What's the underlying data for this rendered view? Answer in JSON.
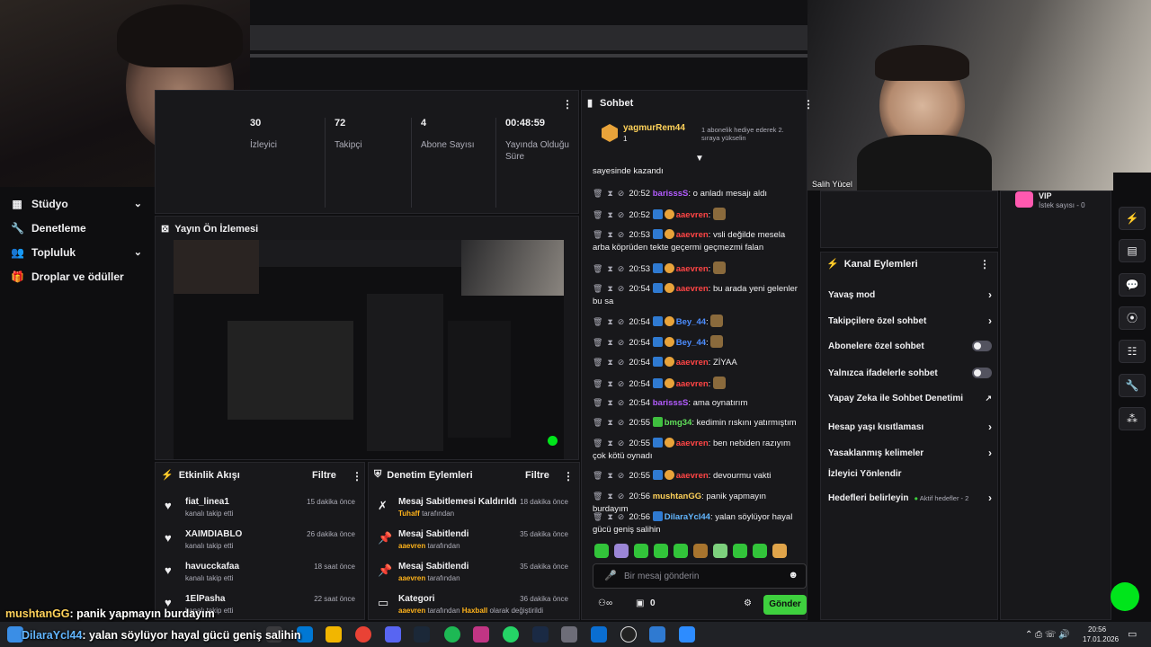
{
  "nav": {
    "items": [
      {
        "label": "Stüdyo",
        "icon": "studio-icon",
        "chevron": true
      },
      {
        "label": "Denetleme",
        "icon": "wrench-icon",
        "chevron": false
      },
      {
        "label": "Topluluk",
        "icon": "people-icon",
        "chevron": true
      },
      {
        "label": "Droplar ve ödüller",
        "icon": "gift-icon",
        "chevron": false
      }
    ]
  },
  "stats": {
    "items": [
      {
        "value": "30",
        "label": "İzleyici"
      },
      {
        "value": "72",
        "label": "Takipçi"
      },
      {
        "value": "4",
        "label": "Abone Sayısı"
      },
      {
        "value": "00:48:59",
        "label": "Yayında Olduğu Süre"
      }
    ]
  },
  "preview": {
    "title": "Yayın Ön İzlemesi"
  },
  "events": {
    "title": "Etkinlik Akışı",
    "filter": "Filtre",
    "items": [
      {
        "name": "fiat_linea1",
        "sub": "kanalı takip etti",
        "time": "15 dakika önce"
      },
      {
        "name": "XAIMDIABLO",
        "sub": "kanalı takip etti",
        "time": "26 dakika önce"
      },
      {
        "name": "havucckafaa",
        "sub": "kanalı takip etti",
        "time": "18 saat önce"
      },
      {
        "name": "1ElPasha",
        "sub": "kanalı takip etti",
        "time": "22 saat önce"
      }
    ]
  },
  "modactions": {
    "title": "Denetim Eylemleri",
    "filter": "Filtre",
    "items": [
      {
        "name": "Mesaj Sabitlemesi Kaldırıldı",
        "actor": "Tuhaff",
        "suffix": "tarafından",
        "time": "18 dakika önce"
      },
      {
        "name": "Mesaj Sabitlendi",
        "actor": "aaevren",
        "suffix": "tarafından",
        "time": "35 dakika önce"
      },
      {
        "name": "Mesaj Sabitlendi",
        "actor": "aaevren",
        "suffix": "tarafından",
        "time": "35 dakika önce"
      },
      {
        "name": "Kategori",
        "actor": "aaevren",
        "suffix": "tarafından",
        "extra": "Haxball",
        "extra_suffix": "olarak değiştirildi",
        "time": "36 dakika önce"
      }
    ]
  },
  "chat": {
    "title": "Sohbet",
    "pinned": {
      "user": "yagmurRem44",
      "count": "1",
      "note": "1 abonelik hediye ederek 2. sıraya yükselin"
    },
    "first_line": "sayesinde kazandı",
    "messages": [
      {
        "time": "20:52",
        "user": "barisssS",
        "color": "purple",
        "text": "o anladı mesajı aldı"
      },
      {
        "time": "20:52",
        "user": "aaevren",
        "color": "red",
        "text": ""
      },
      {
        "time": "20:53",
        "user": "aaevren",
        "color": "red",
        "text": "vsli değilde mesela arba köprüden tekte geçermi geçmezmi falan"
      },
      {
        "time": "20:53",
        "user": "aaevren",
        "color": "red",
        "text": ""
      },
      {
        "time": "20:54",
        "user": "aaevren",
        "color": "red",
        "text": "bu arada yeni gelenler bu sa"
      },
      {
        "time": "20:54",
        "user": "Bey_44",
        "color": "blue",
        "text": ""
      },
      {
        "time": "20:54",
        "user": "Bey_44",
        "color": "blue",
        "text": ""
      },
      {
        "time": "20:54",
        "user": "aaevren",
        "color": "red",
        "text": "ZİYAA"
      },
      {
        "time": "20:54",
        "user": "aaevren",
        "color": "red",
        "text": ""
      },
      {
        "time": "20:54",
        "user": "barisssS",
        "color": "purple",
        "text": "ama oynatırım"
      },
      {
        "time": "20:55",
        "user": "bmg34",
        "color": "green",
        "text": "kedimin rıskını yatırmıştım"
      },
      {
        "time": "20:55",
        "user": "aaevren",
        "color": "red",
        "text": "ben nebiden razıyım çok kötü oynadı"
      },
      {
        "time": "20:55",
        "user": "aaevren",
        "color": "red",
        "text": "devourmu vakti"
      },
      {
        "time": "20:56",
        "user": "mushtanGG",
        "color": "yellow",
        "text": "panik yapmayın burdayım"
      },
      {
        "time": "20:56",
        "user": "DilaraYcl44",
        "color": "cyan",
        "text": "yalan söylüyor hayal gücü geniş salihin"
      }
    ],
    "input_placeholder": "Bir mesaj gönderin",
    "points": "0",
    "send_label": "Gönder"
  },
  "channel_actions": {
    "title": "Kanal Eylemleri",
    "items": [
      {
        "label": "Yavaş mod",
        "control": "chevron"
      },
      {
        "label": "Takipçilere özel sohbet",
        "control": "chevron"
      },
      {
        "label": "Abonelere özel sohbet",
        "control": "toggle"
      },
      {
        "label": "Yalnızca ifadelerle sohbet",
        "control": "toggle"
      },
      {
        "label": "Yapay Zeka ile Sohbet Denetimi",
        "control": "external"
      },
      {
        "label": "Hesap yaşı kısıtlaması",
        "control": "chevron"
      },
      {
        "label": "Yasaklanmış kelimeler",
        "control": "chevron"
      },
      {
        "label": "İzleyici Yönlendir",
        "control": "none"
      },
      {
        "label": "Hedefleri belirleyin",
        "control": "chevron",
        "note": "Aktif hedefler - 2"
      }
    ]
  },
  "vip": {
    "title": "VIP",
    "sub": "İstek sayısı - 0"
  },
  "cam_right_label": "Salih Yücel",
  "overlay": {
    "line1_user": "mushtanGG",
    "line1_text": ": panik yapmayın burdayım",
    "line2_user": "DilaraYcl44",
    "line2_text": ": yalan söylüyor hayal gücü geniş salihin"
  },
  "taskbar": {
    "time": "20:56",
    "date": "17.01.2026"
  },
  "colors": {
    "accent_green": "#53fc18",
    "bg": "#0e0e10",
    "panel": "#18181b"
  }
}
